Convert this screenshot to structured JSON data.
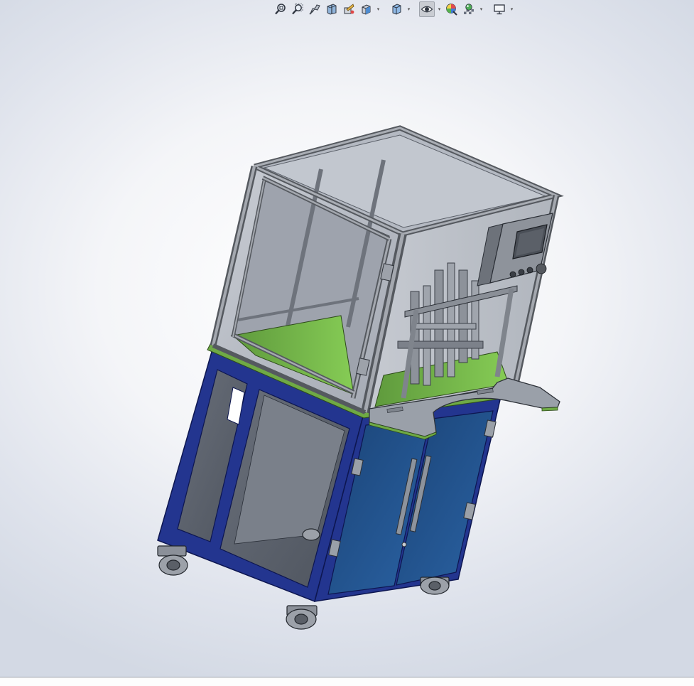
{
  "toolbar": {
    "buttons": [
      {
        "name": "zoom-to-fit-button",
        "icon": "zoom-fit-icon",
        "dropdown": false
      },
      {
        "name": "zoom-to-area-button",
        "icon": "zoom-area-icon",
        "dropdown": false
      },
      {
        "name": "previous-view-button",
        "icon": "previous-view-icon",
        "dropdown": false
      },
      {
        "name": "section-view-button",
        "icon": "section-view-icon",
        "dropdown": false
      },
      {
        "name": "dynamic-annotation-button",
        "icon": "annotation-view-icon",
        "dropdown": false
      },
      {
        "name": "view-orientation-button",
        "icon": "view-orientation-icon",
        "dropdown": true
      },
      {
        "name": "display-style-button",
        "icon": "display-style-icon",
        "dropdown": true
      },
      {
        "name": "hide-show-items-button",
        "icon": "eye-icon",
        "dropdown": true,
        "active": true
      },
      {
        "name": "edit-appearance-button",
        "icon": "appearance-icon",
        "dropdown": false
      },
      {
        "name": "apply-scene-button",
        "icon": "scene-icon",
        "dropdown": true
      },
      {
        "name": "view-settings-button",
        "icon": "monitor-icon",
        "dropdown": true
      }
    ]
  },
  "colors": {
    "frame_blue": "#23358f",
    "panel_gray": "#5d6470",
    "aluminum": "#8c9097",
    "glass": "#b9bec7",
    "work_surface_green": "#7bc04a",
    "table_plate": "#9aa0a9",
    "door_blue": "#1f4f8a",
    "toolbar_active": "#c9ccd2"
  }
}
